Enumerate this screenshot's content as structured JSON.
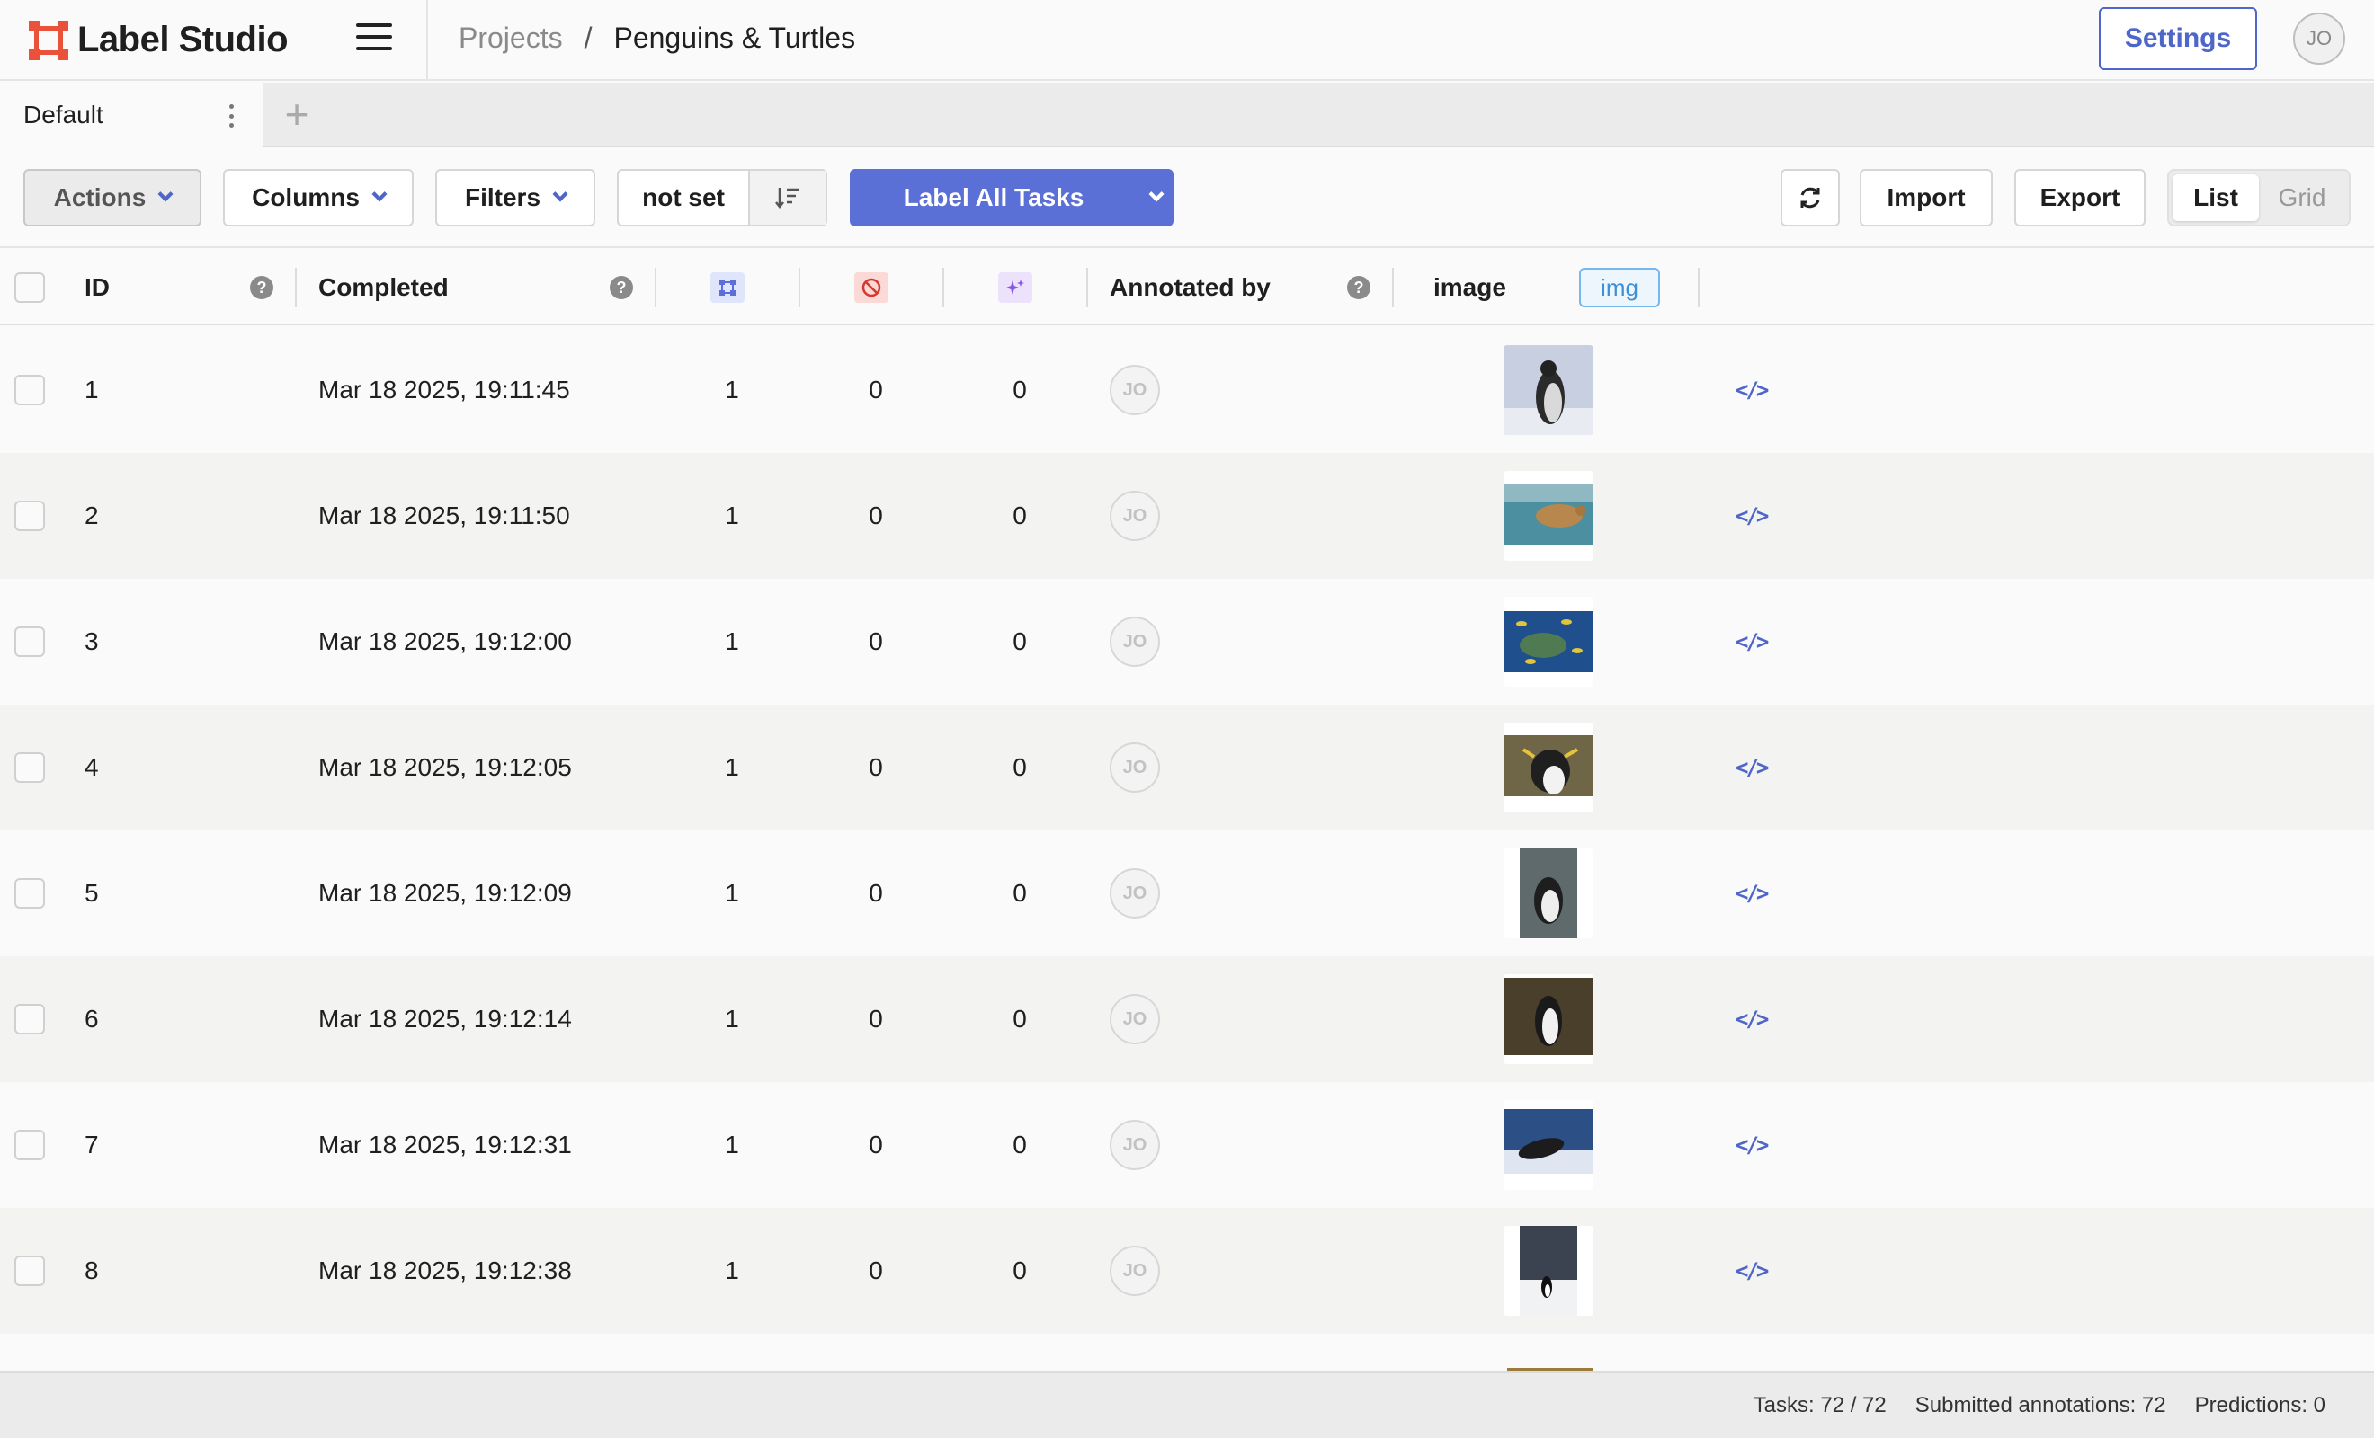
{
  "app": {
    "name": "Label Studio"
  },
  "breadcrumb": {
    "projects": "Projects",
    "separator": "/",
    "current": "Penguins & Turtles"
  },
  "header": {
    "settings_label": "Settings",
    "user_initials": "JO"
  },
  "tabs": [
    {
      "label": "Default"
    }
  ],
  "toolbar": {
    "actions_label": "Actions",
    "columns_label": "Columns",
    "filters_label": "Filters",
    "sort_value": "not set",
    "label_all_label": "Label All Tasks",
    "import_label": "Import",
    "export_label": "Export",
    "view_list": "List",
    "view_grid": "Grid",
    "active_view": "List"
  },
  "columns": {
    "id": "ID",
    "completed": "Completed",
    "annotated_by": "Annotated by",
    "image": "image",
    "image_tag": "img"
  },
  "rows": [
    {
      "id": "1",
      "completed": "Mar 18 2025, 19:11:45",
      "annotations": "1",
      "cancelled": "0",
      "predictions": "0",
      "annotator": "JO",
      "thumb": "penguin-snow"
    },
    {
      "id": "2",
      "completed": "Mar 18 2025, 19:11:50",
      "annotations": "1",
      "cancelled": "0",
      "predictions": "0",
      "annotator": "JO",
      "thumb": "turtle-underwater"
    },
    {
      "id": "3",
      "completed": "Mar 18 2025, 19:12:00",
      "annotations": "1",
      "cancelled": "0",
      "predictions": "0",
      "annotator": "JO",
      "thumb": "turtle-fish"
    },
    {
      "id": "4",
      "completed": "Mar 18 2025, 19:12:05",
      "annotations": "1",
      "cancelled": "0",
      "predictions": "0",
      "annotator": "JO",
      "thumb": "penguin-rockhopper"
    },
    {
      "id": "5",
      "completed": "Mar 18 2025, 19:12:09",
      "annotations": "1",
      "cancelled": "0",
      "predictions": "0",
      "annotator": "JO",
      "thumb": "penguin-rocks"
    },
    {
      "id": "6",
      "completed": "Mar 18 2025, 19:12:14",
      "annotations": "1",
      "cancelled": "0",
      "predictions": "0",
      "annotator": "JO",
      "thumb": "penguin-brown"
    },
    {
      "id": "7",
      "completed": "Mar 18 2025, 19:12:31",
      "annotations": "1",
      "cancelled": "0",
      "predictions": "0",
      "annotator": "JO",
      "thumb": "penguin-swimming"
    },
    {
      "id": "8",
      "completed": "Mar 18 2025, 19:12:38",
      "annotations": "1",
      "cancelled": "0",
      "predictions": "0",
      "annotator": "JO",
      "thumb": "penguin-standing"
    }
  ],
  "footer": {
    "tasks": "Tasks: 72 / 72",
    "submitted": "Submitted annotations: 72",
    "predictions": "Predictions: 0"
  },
  "colors": {
    "accent": "#5b70d6",
    "brand": "#e9513a",
    "link": "#4e66c9",
    "tag": "#3d8fd6"
  }
}
